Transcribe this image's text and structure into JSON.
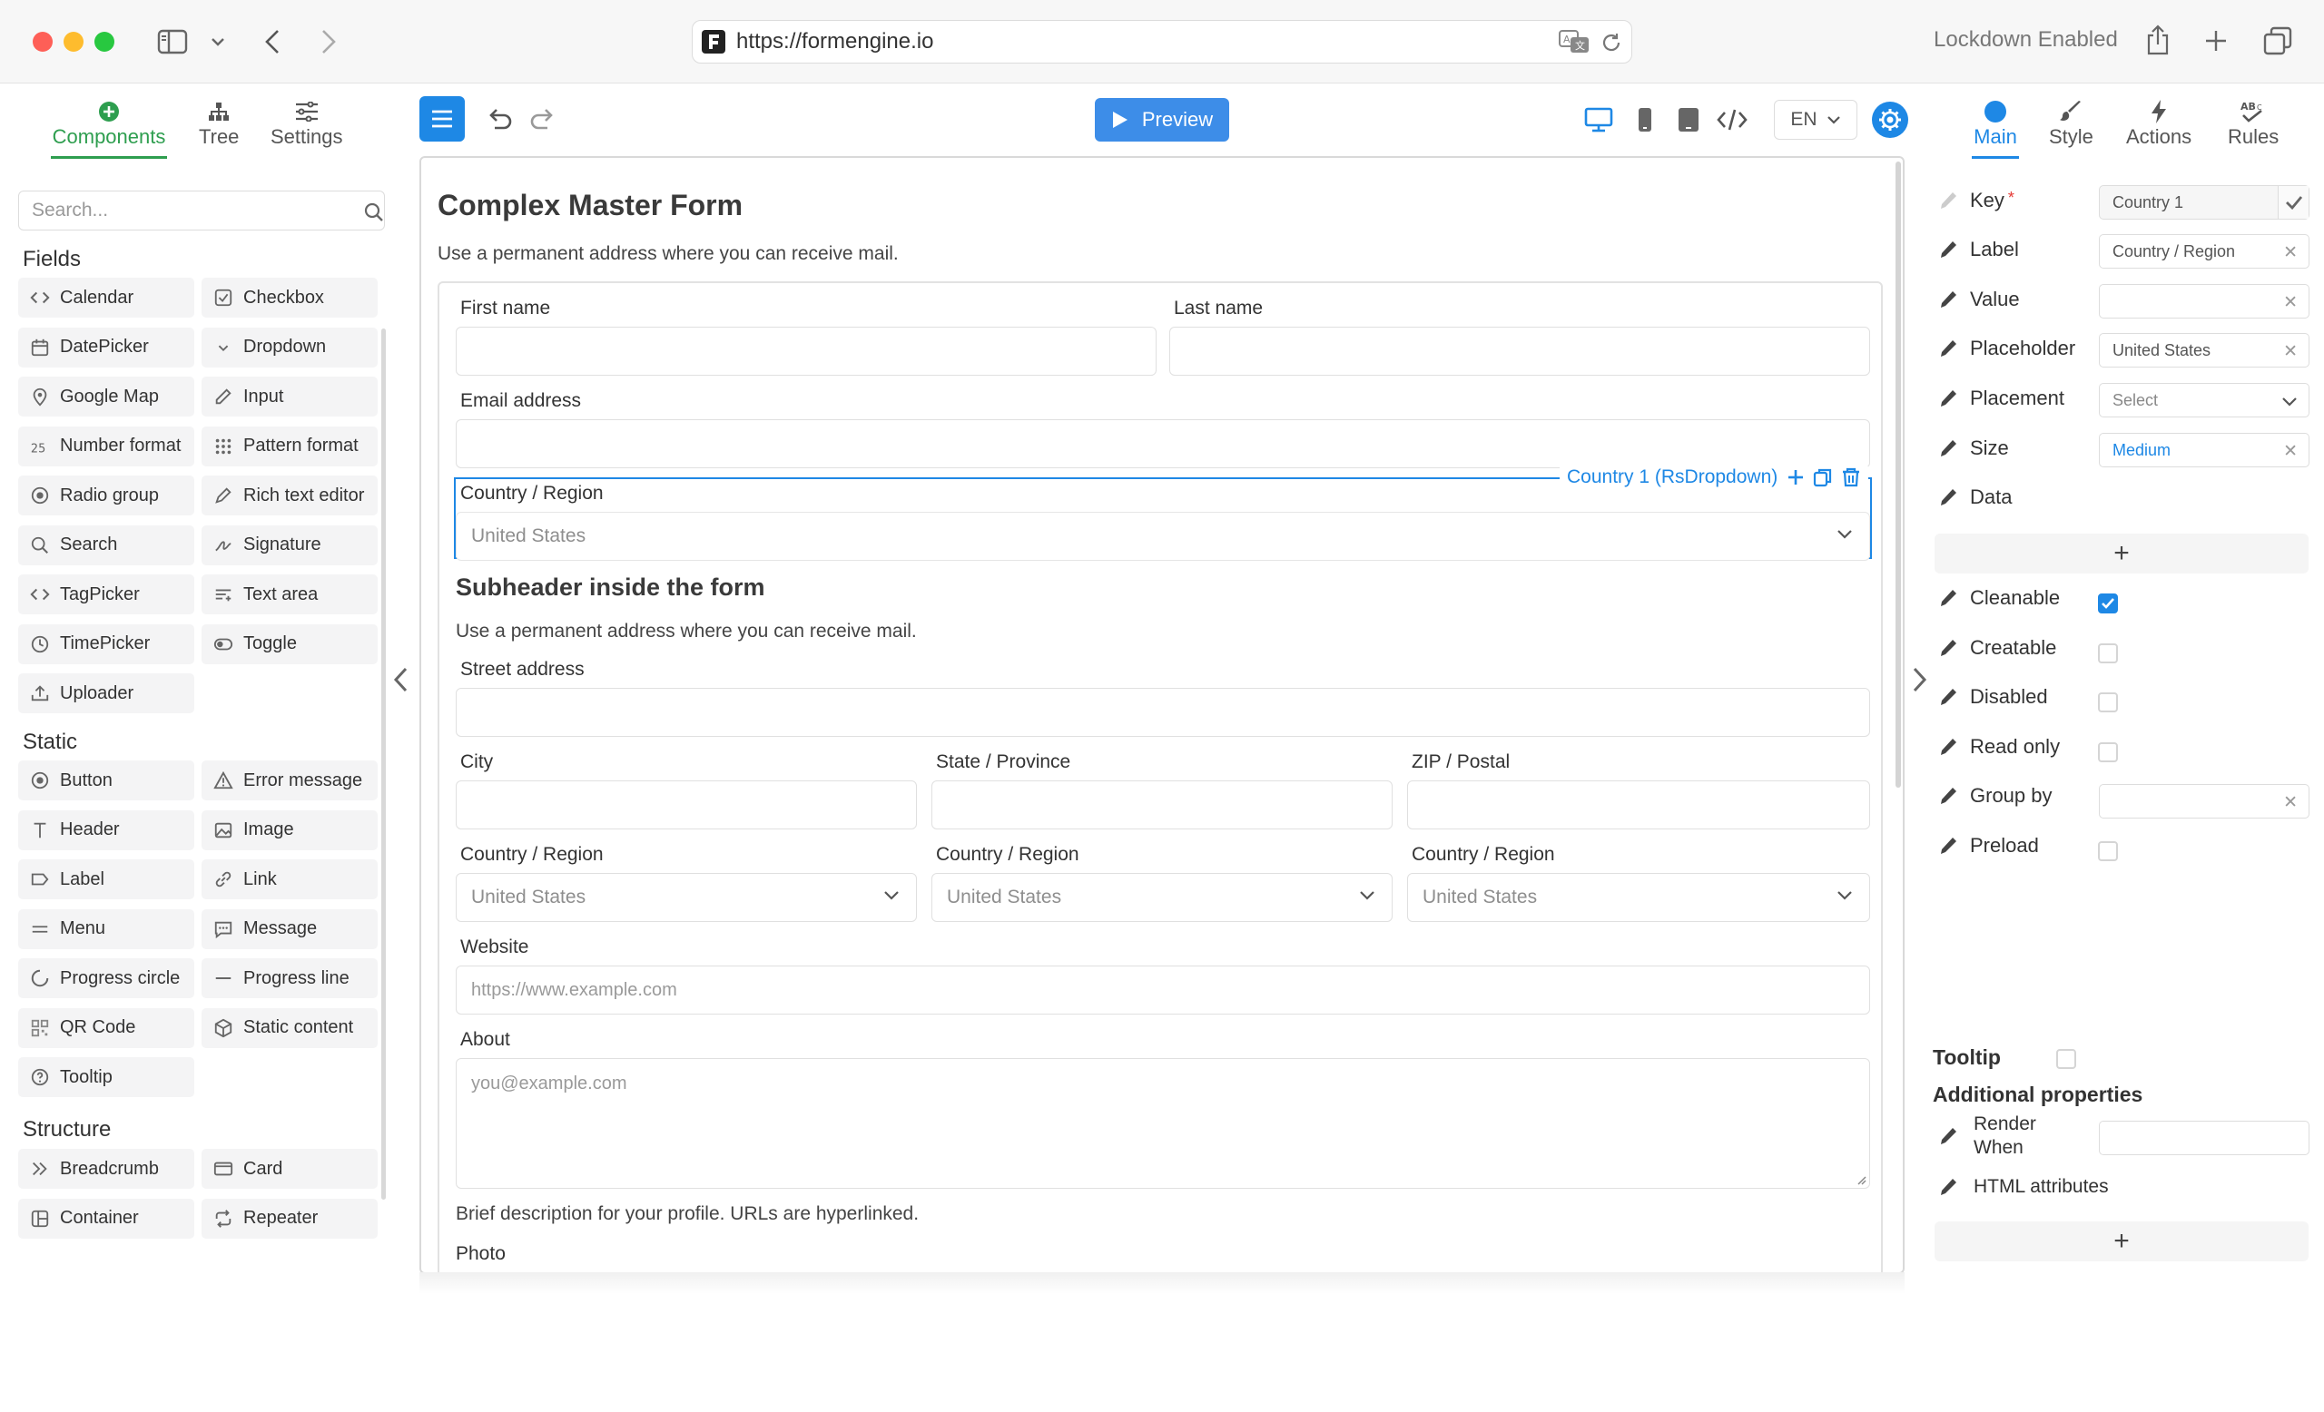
{
  "browser": {
    "url": "https://formengine.io",
    "lockdown": "Lockdown Enabled"
  },
  "left_panel": {
    "tabs": [
      {
        "label": "Components",
        "icon": "plus-circle-icon",
        "active": true
      },
      {
        "label": "Tree",
        "icon": "tree-icon"
      },
      {
        "label": "Settings",
        "icon": "sliders-icon"
      }
    ],
    "search_placeholder": "Search...",
    "sections": {
      "fields": "Fields",
      "static": "Static",
      "structure": "Structure"
    },
    "fields": [
      "Calendar",
      "Checkbox",
      "DatePicker",
      "Dropdown",
      "Google Map",
      "Input",
      "Number format",
      "Pattern format",
      "Radio group",
      "Rich text editor",
      "Search",
      "Signature",
      "TagPicker",
      "Text area",
      "TimePicker",
      "Toggle",
      "Uploader"
    ],
    "static": [
      "Button",
      "Error message",
      "Header",
      "Image",
      "Label",
      "Link",
      "Menu",
      "Message",
      "Progress circle",
      "Progress line",
      "QR Code",
      "Static content",
      "Tooltip"
    ],
    "structure": [
      "Breadcrumb",
      "Card",
      "Container",
      "Repeater"
    ]
  },
  "toolbar": {
    "preview": "Preview",
    "lang": "EN"
  },
  "form": {
    "title": "Complex Master Form",
    "subtitle": "Use a permanent address where you can receive mail.",
    "first_name": "First name",
    "last_name": "Last name",
    "email": "Email address",
    "country_label": "Country / Region",
    "country_value": "United States",
    "selected_tag": "Country 1 (RsDropdown)",
    "subheader": "Subheader inside the form",
    "subheader_text": "Use a permanent address where you can receive mail.",
    "street": "Street address",
    "city": "City",
    "state": "State / Province",
    "zip": "ZIP / Postal",
    "country_row": [
      {
        "label": "Country / Region",
        "value": "United States"
      },
      {
        "label": "Country / Region",
        "value": "United States"
      },
      {
        "label": "Country / Region",
        "value": "United States"
      }
    ],
    "website": "Website",
    "website_placeholder": "https://www.example.com",
    "about": "About",
    "about_placeholder": "you@example.com",
    "about_help": "Brief description for your profile. URLs are hyperlinked.",
    "photo": "Photo"
  },
  "right_panel": {
    "tabs": [
      {
        "label": "Main",
        "active": true
      },
      {
        "label": "Style"
      },
      {
        "label": "Actions"
      },
      {
        "label": "Rules"
      }
    ],
    "props": {
      "key": {
        "label": "Key",
        "value": "Country 1"
      },
      "label": {
        "label": "Label",
        "value": "Country / Region"
      },
      "value": {
        "label": "Value",
        "value": ""
      },
      "placeholder": {
        "label": "Placeholder",
        "value": "United States"
      },
      "placement": {
        "label": "Placement",
        "value": "Select"
      },
      "size": {
        "label": "Size",
        "value": "Medium"
      },
      "data": {
        "label": "Data"
      },
      "cleanable": {
        "label": "Cleanable",
        "checked": true
      },
      "creatable": {
        "label": "Creatable",
        "checked": false
      },
      "disabled": {
        "label": "Disabled",
        "checked": false
      },
      "read_only": {
        "label": "Read only",
        "checked": false
      },
      "group_by": {
        "label": "Group by",
        "value": ""
      },
      "preload": {
        "label": "Preload",
        "checked": false
      }
    },
    "tooltip": "Tooltip",
    "additional": "Additional properties",
    "render_when_1": "Render",
    "render_when_2": "When",
    "html_attributes": "HTML attributes",
    "add_symbol": "+"
  },
  "colors": {
    "accent": "#1e88e5",
    "green": "#2e9e4f",
    "preview_btn": "#3d8de8"
  }
}
